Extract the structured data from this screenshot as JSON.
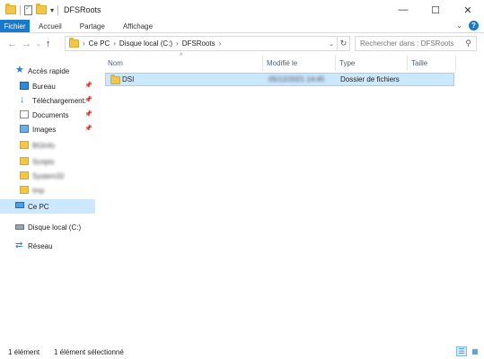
{
  "window": {
    "title": "DFSRoots",
    "minimize": "—",
    "maximize": "☐",
    "close": "✕"
  },
  "ribbon": {
    "tabs": [
      "Fichier",
      "Accueil",
      "Partage",
      "Affichage"
    ],
    "help": "?",
    "file_tab_color": "#1979ca"
  },
  "address": {
    "back": "←",
    "forward": "→",
    "recent": "⌄",
    "up": "↑",
    "breadcrumb": [
      "Ce PC",
      "Disque local (C:)",
      "DFSRoots"
    ],
    "separator": "›",
    "search_placeholder": "Rechercher dans : DFSRoots"
  },
  "nav": {
    "quick_access": "Accès rapide",
    "pinned": [
      {
        "label": "Bureau",
        "icon": "desktop-icon"
      },
      {
        "label": "Téléchargement:",
        "icon": "download-icon"
      },
      {
        "label": "Documents",
        "icon": "documents-icon"
      },
      {
        "label": "Images",
        "icon": "pictures-icon"
      }
    ],
    "recent_folders": [
      "BGInfo",
      "Scripts",
      "System32",
      "tmp"
    ],
    "this_pc": "Ce PC",
    "local_disk": "Disque local (C:)",
    "network": "Réseau",
    "selection_color": "#cce8ff"
  },
  "columns": {
    "name": "Nom",
    "modified": "Modifié le",
    "type": "Type",
    "size": "Taille"
  },
  "files": [
    {
      "name": "DSI",
      "modified": "05/12/2021 14:45",
      "type": "Dossier de fichiers",
      "size": "",
      "selected": true
    }
  ],
  "status": {
    "count": "1 élément",
    "selection": "1 élément sélectionné"
  }
}
